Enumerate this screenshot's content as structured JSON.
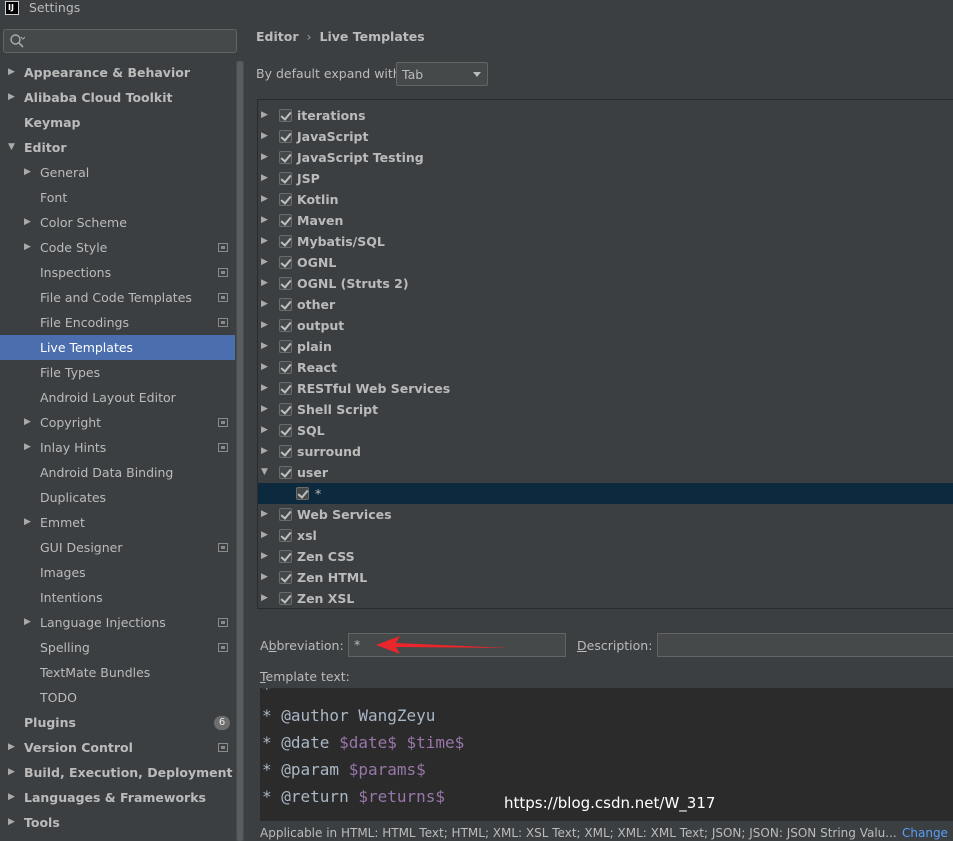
{
  "window": {
    "title": "Settings"
  },
  "sidebar": {
    "search_placeholder": "",
    "items": [
      {
        "label": "Appearance & Behavior",
        "level": 0,
        "expander": "collapsed",
        "bold": true
      },
      {
        "label": "Alibaba Cloud Toolkit",
        "level": 0,
        "expander": "collapsed",
        "bold": true
      },
      {
        "label": "Keymap",
        "level": 0,
        "expander": "none",
        "bold": true
      },
      {
        "label": "Editor",
        "level": 0,
        "expander": "expanded",
        "bold": true
      },
      {
        "label": "General",
        "level": 1,
        "expander": "collapsed"
      },
      {
        "label": "Font",
        "level": 1,
        "expander": "none"
      },
      {
        "label": "Color Scheme",
        "level": 1,
        "expander": "collapsed"
      },
      {
        "label": "Code Style",
        "level": 1,
        "expander": "collapsed",
        "project": true
      },
      {
        "label": "Inspections",
        "level": 1,
        "expander": "none",
        "project": true
      },
      {
        "label": "File and Code Templates",
        "level": 1,
        "expander": "none",
        "project": true
      },
      {
        "label": "File Encodings",
        "level": 1,
        "expander": "none",
        "project": true
      },
      {
        "label": "Live Templates",
        "level": 1,
        "expander": "none",
        "selected": true
      },
      {
        "label": "File Types",
        "level": 1,
        "expander": "none"
      },
      {
        "label": "Android Layout Editor",
        "level": 1,
        "expander": "none"
      },
      {
        "label": "Copyright",
        "level": 1,
        "expander": "collapsed",
        "project": true
      },
      {
        "label": "Inlay Hints",
        "level": 1,
        "expander": "collapsed",
        "project": true
      },
      {
        "label": "Android Data Binding",
        "level": 1,
        "expander": "none"
      },
      {
        "label": "Duplicates",
        "level": 1,
        "expander": "none"
      },
      {
        "label": "Emmet",
        "level": 1,
        "expander": "collapsed"
      },
      {
        "label": "GUI Designer",
        "level": 1,
        "expander": "none",
        "project": true
      },
      {
        "label": "Images",
        "level": 1,
        "expander": "none"
      },
      {
        "label": "Intentions",
        "level": 1,
        "expander": "none"
      },
      {
        "label": "Language Injections",
        "level": 1,
        "expander": "collapsed",
        "project": true
      },
      {
        "label": "Spelling",
        "level": 1,
        "expander": "none",
        "project": true
      },
      {
        "label": "TextMate Bundles",
        "level": 1,
        "expander": "none"
      },
      {
        "label": "TODO",
        "level": 1,
        "expander": "none"
      },
      {
        "label": "Plugins",
        "level": 0,
        "expander": "none",
        "bold": true,
        "badge": "6"
      },
      {
        "label": "Version Control",
        "level": 0,
        "expander": "collapsed",
        "bold": true,
        "project": true
      },
      {
        "label": "Build, Execution, Deployment",
        "level": 0,
        "expander": "collapsed",
        "bold": true
      },
      {
        "label": "Languages & Frameworks",
        "level": 0,
        "expander": "collapsed",
        "bold": true
      },
      {
        "label": "Tools",
        "level": 0,
        "expander": "collapsed",
        "bold": true
      }
    ]
  },
  "main": {
    "breadcrumb": [
      "Editor",
      "Live Templates"
    ],
    "expand_label": "By default expand with",
    "expand_value": "Tab",
    "template_groups": [
      {
        "name": "iterations",
        "checked": true,
        "expander": "collapsed"
      },
      {
        "name": "JavaScript",
        "checked": true,
        "expander": "collapsed"
      },
      {
        "name": "JavaScript Testing",
        "checked": true,
        "expander": "collapsed"
      },
      {
        "name": "JSP",
        "checked": true,
        "expander": "collapsed"
      },
      {
        "name": "Kotlin",
        "checked": true,
        "expander": "collapsed"
      },
      {
        "name": "Maven",
        "checked": true,
        "expander": "collapsed"
      },
      {
        "name": "Mybatis/SQL",
        "checked": true,
        "expander": "collapsed"
      },
      {
        "name": "OGNL",
        "checked": true,
        "expander": "collapsed"
      },
      {
        "name": "OGNL (Struts 2)",
        "checked": true,
        "expander": "collapsed"
      },
      {
        "name": "other",
        "checked": true,
        "expander": "collapsed"
      },
      {
        "name": "output",
        "checked": true,
        "expander": "collapsed"
      },
      {
        "name": "plain",
        "checked": true,
        "expander": "collapsed"
      },
      {
        "name": "React",
        "checked": true,
        "expander": "collapsed"
      },
      {
        "name": "RESTful Web Services",
        "checked": true,
        "expander": "collapsed"
      },
      {
        "name": "Shell Script",
        "checked": true,
        "expander": "collapsed"
      },
      {
        "name": "SQL",
        "checked": true,
        "expander": "collapsed"
      },
      {
        "name": "surround",
        "checked": true,
        "expander": "collapsed"
      },
      {
        "name": "user",
        "checked": true,
        "expander": "expanded"
      },
      {
        "name": "*",
        "checked": true,
        "child": true,
        "selected": true
      },
      {
        "name": "Web Services",
        "checked": true,
        "expander": "collapsed"
      },
      {
        "name": "xsl",
        "checked": true,
        "expander": "collapsed"
      },
      {
        "name": "Zen CSS",
        "checked": true,
        "expander": "collapsed"
      },
      {
        "name": "Zen HTML",
        "checked": true,
        "expander": "collapsed"
      },
      {
        "name": "Zen XSL",
        "checked": true,
        "expander": "collapsed"
      }
    ],
    "abbreviation_label_pre": "A",
    "abbreviation_label_u": "b",
    "abbreviation_label_post": "breviation:",
    "abbreviation_value": "*",
    "description_label_u": "D",
    "description_label_post": "escription:",
    "description_value": "",
    "template_label_u": "T",
    "template_label_post": "emplate text:",
    "template_lines": [
      [
        {
          "t": "*"
        }
      ],
      [
        {
          "t": "* @author WangZeyu"
        }
      ],
      [
        {
          "t": "* @date "
        },
        {
          "t": "$date$",
          "v": true
        },
        {
          "t": " "
        },
        {
          "t": "$time$",
          "v": true
        }
      ],
      [
        {
          "t": "* @param "
        },
        {
          "t": "$params$",
          "v": true
        }
      ],
      [
        {
          "t": "* @return "
        },
        {
          "t": "$returns$",
          "v": true
        }
      ]
    ],
    "applicable": "Applicable in HTML: HTML Text; HTML; XML: XSL Text; XML; XML: XML Text; JSON; JSON: JSON String Valu...",
    "change_label": "Change ∨",
    "watermark": "https://blog.csdn.net/W_317"
  },
  "colors": {
    "background": "#3c3f41",
    "selection": "#4b6eaf",
    "child_selection": "#0d293e",
    "editor_bg": "#2b2b2b",
    "template_var": "#9876aa",
    "link": "#589df6",
    "annotation_arrow": "#e8262b"
  },
  "icons": [
    "search-icon",
    "project-scope-icon",
    "expand-arrow-icon",
    "collapse-arrow-icon",
    "checkbox-checked-icon",
    "dropdown-caret-icon",
    "red-arrow-annotation"
  ]
}
